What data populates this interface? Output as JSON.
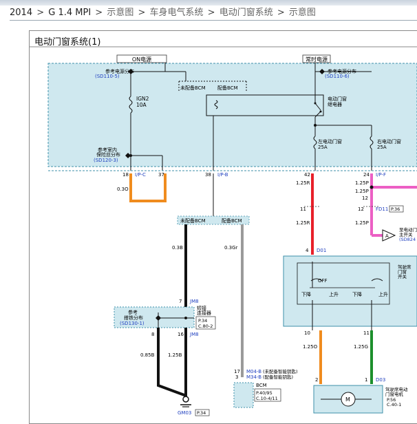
{
  "breadcrumb": [
    "2014",
    "G 1.4 MPI",
    "示意图",
    "车身电气系统",
    "电动门窗系统",
    "示意图"
  ],
  "diagram_title": "电动门窗系统(1)",
  "colors": {
    "panel_fill": "#cfe8ef",
    "panel_border": "#3c8fa8",
    "wire_orange": "#f08c1e",
    "wire_red": "#e8202a",
    "wire_pink": "#ec5fc4",
    "wire_green": "#1c8f2c",
    "wire_black": "#111111",
    "wire_gray": "#9a9a9a",
    "ref_blue": "#1f3fbf"
  },
  "labels": {
    "on_power": "ON电源",
    "constant_power": "常时电源",
    "ref_power_left": "参考电源分布",
    "ref_power_left_code": "(SD110-5)",
    "ref_power_right": "参考电源分布",
    "ref_power_right_code": "(SD110-6)",
    "no_bcm": "未配备BCM",
    "with_bcm": "配备BCM",
    "ign2": "IGN2",
    "ign2_amp": "10A",
    "power_window_relay_1": "电动门窗",
    "power_window_relay_2": "继电器",
    "left_window_fuse_1": "左电动门窗",
    "left_window_fuse_amp": "25A",
    "right_window_fuse_1": "右电动门窗",
    "right_window_fuse_amp": "25A",
    "ref_interior_1": "参考室内",
    "ref_interior_2": "保险丝分布",
    "ref_interior_code": "(SD120-3)",
    "pin_18": "18",
    "pin_37": "37",
    "pin_38": "38",
    "pin_42": "42",
    "pin_24": "24",
    "conn_ip_c": "I/P-C",
    "conn_ip_b": "I/P-B",
    "conn_ip_f": "I/P-F",
    "wire_03o": "0.3O",
    "wire_125r_a": "1.25R",
    "wire_125p_a": "1.25P",
    "pin_12": "12",
    "wire_125p_b": "1.25P",
    "pin_11": "11",
    "pin_12b": "12",
    "conn_fd11": "FD11",
    "ref_p36": "P.36",
    "wire_125r_b": "1.25R",
    "wire_125p_c": "1.25P",
    "bus_no_bcm": "未配备BCM",
    "bus_with_bcm": "配备BCM",
    "passenger_switch_1": "至电动门",
    "passenger_switch_2": "主开关",
    "passenger_switch_code": "(SD824",
    "marker_a": "A",
    "wire_03b": "0.3B",
    "wire_03gr": "0.3Gr",
    "pin_4": "4",
    "conn_d01": "D01",
    "pin_7": "7",
    "conn_jm8_a": "JM8",
    "ref_ground_1": "参考",
    "ref_ground_2": "搭铁分布",
    "ref_ground_code": "(SD130-1)",
    "short_conn_1": "短接",
    "short_conn_2": "连接器",
    "short_conn_p": "P.34",
    "short_conn_c": "C.80-2",
    "pin_16": "16",
    "conn_jm8_b": "JM8",
    "pin_8": "8",
    "wire_085b": "0.85B",
    "wire_125b": "1.25B",
    "driver_switch_1": "驾驶席",
    "driver_switch_2": "门窗",
    "driver_switch_3": "开关",
    "off_label": "OFF",
    "down_1": "下降",
    "up_1": "上升",
    "down_2": "下降",
    "up_2": "上升",
    "pin_10": "10",
    "pin_11b": "11",
    "wire_125o": "1.25O",
    "wire_125g": "1.25G",
    "pin_17": "17",
    "pin_3": "3",
    "conn_m04b": "M04-B",
    "m04b_note": "(未配备智能钥匙)",
    "conn_m34b": "M34-B",
    "m34b_note": "(配备智能钥匙)",
    "bcm": "BCM",
    "bcm_p": "P.40/95",
    "bcm_c": "C.10-4/11",
    "pin_2": "2",
    "pin_1": "1",
    "conn_d03": "D03",
    "motor_m": "M",
    "motor_1": "驾驶席电动",
    "motor_2": "门窗电机",
    "motor_p": "P.56",
    "motor_c": "C.40-1",
    "ground": "GM03",
    "ground_p": "P.34"
  }
}
